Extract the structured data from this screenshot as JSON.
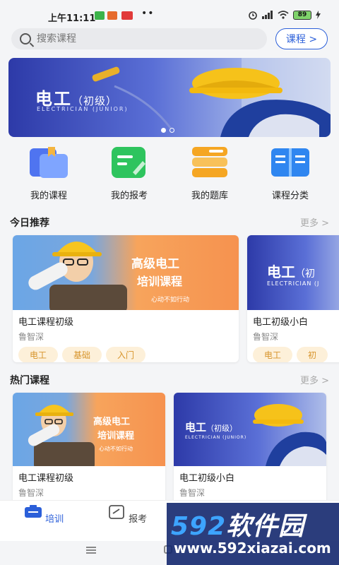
{
  "status": {
    "time": "上午11:11",
    "battery": "89"
  },
  "search": {
    "placeholder": "搜索课程",
    "course_button": "课程 >"
  },
  "banner": {
    "title": "电工",
    "title_suffix": "（初级）",
    "subtitle": "ELECTRICIAN (JUNIOR)",
    "slide_count": 2,
    "active_slide": 1
  },
  "quick_links": [
    {
      "label": "我的课程",
      "icon": "course-book-icon"
    },
    {
      "label": "我的报考",
      "icon": "exam-register-icon"
    },
    {
      "label": "我的题库",
      "icon": "question-bank-icon"
    },
    {
      "label": "课程分类",
      "icon": "category-book-icon"
    }
  ],
  "today": {
    "title": "今日推荐",
    "more": "更多 >",
    "cards": [
      {
        "promo_title_1": "高级电工",
        "promo_title_2": "培训课程",
        "promo_sub": "心动不如行动",
        "title": "电工课程初级",
        "author": "鲁智深",
        "tags": [
          "电工",
          "基础",
          "入门"
        ]
      },
      {
        "banner_title": "电工",
        "banner_suffix": "（初",
        "banner_sub": "ELECTRICIAN (J",
        "title": "电工初级小白",
        "author": "鲁智深",
        "tags": [
          "电工",
          "初"
        ]
      }
    ]
  },
  "hot": {
    "title": "热门课程",
    "more": "更多 >",
    "cards": [
      {
        "promo_title_1": "高级电工",
        "promo_title_2": "培训课程",
        "promo_sub": "心动不如行动",
        "title": "电工课程初级",
        "author": "鲁智深"
      },
      {
        "banner_title": "电工",
        "banner_suffix": "（初级）",
        "banner_sub": "ELECTRICIAN (JUNIOR)",
        "title": "电工初级小白",
        "author": "鲁智深"
      }
    ]
  },
  "tabs": [
    {
      "label": "培训",
      "active": true
    },
    {
      "label": "报考",
      "active": false
    }
  ],
  "watermark": {
    "brand_num": "592",
    "brand_text": "软件园",
    "url": "www.592xiazai.com"
  },
  "colors": {
    "accent": "#2b5fd9",
    "tag_bg": "#fdf0d9",
    "tag_text": "#d7942b"
  }
}
